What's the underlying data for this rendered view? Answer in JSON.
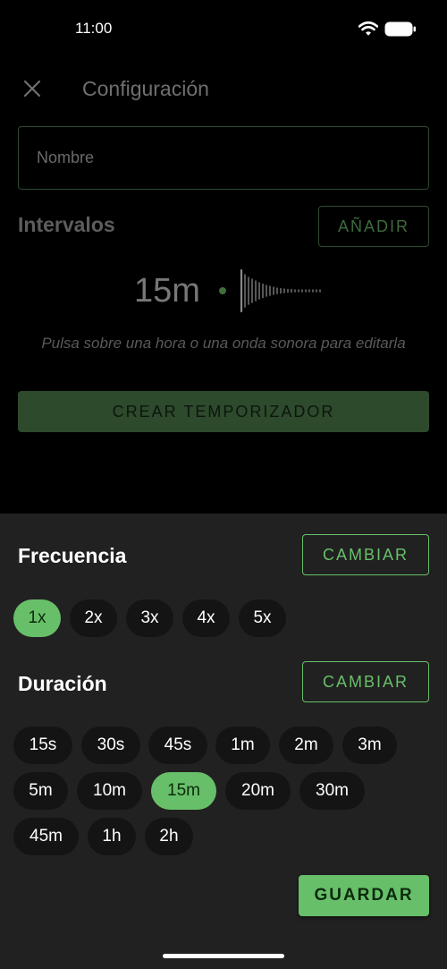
{
  "status_bar": {
    "time": "11:00",
    "icons": [
      "wifi-icon",
      "battery-icon"
    ]
  },
  "background": {
    "title": "Configuración",
    "close_icon": "close-icon",
    "name_field": {
      "placeholder": "Nombre",
      "value": ""
    },
    "intervals_title": "Intervalos",
    "add_label": "AÑADIR",
    "interval_time": "15m",
    "hint": "Pulsa sobre una hora o una onda sonora para editarla",
    "create_label": "CREAR TEMPORIZADOR"
  },
  "sheet": {
    "frequency": {
      "title": "Frecuencia",
      "change_label": "CAMBIAR",
      "options": [
        "1x",
        "2x",
        "3x",
        "4x",
        "5x"
      ],
      "selected": "1x"
    },
    "duration": {
      "title": "Duración",
      "change_label": "CAMBIAR",
      "options": [
        "15s",
        "30s",
        "45s",
        "1m",
        "2m",
        "3m",
        "5m",
        "10m",
        "15m",
        "20m",
        "30m",
        "45m",
        "1h",
        "2h"
      ],
      "selected": "15m"
    },
    "save_label": "GUARDAR"
  },
  "colors": {
    "accent": "#68bf69",
    "sheet_background": "#212121",
    "chip_background": "#141414",
    "dimmed_accent": "#2d4a2c"
  }
}
